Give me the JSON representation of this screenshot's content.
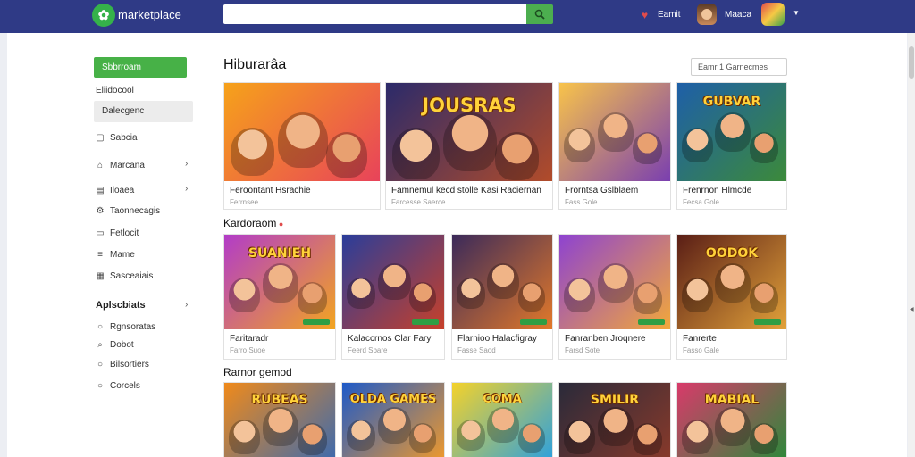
{
  "header": {
    "brand": "marketplace",
    "search_placeholder": "",
    "notif_label": "Eamit",
    "user_label": "Maaca"
  },
  "sidebar": {
    "primary_button": "Sbbrroam",
    "subtitle": "Eliidocool",
    "active_item": "Dalecgenc",
    "items": [
      {
        "label": "Sabcia",
        "icon": "square-icon"
      },
      {
        "label": "Marcana",
        "icon": "tag-icon"
      },
      {
        "label": "Iloaea",
        "icon": "bag-icon"
      },
      {
        "label": "Taonnecagis",
        "icon": "gear-icon"
      },
      {
        "label": "Fetlocit",
        "icon": "doc-icon"
      },
      {
        "label": "Mame",
        "icon": "list-icon"
      },
      {
        "label": "Sasceaiais",
        "icon": "grid-icon"
      }
    ],
    "section_title": "Aplscbiats",
    "section_items": [
      {
        "label": "Rgnsoratas",
        "icon": "circle-icon"
      },
      {
        "label": "Dobot",
        "icon": "search-icon"
      },
      {
        "label": "Bilsortiers",
        "icon": "circle-icon"
      },
      {
        "label": "Corcels",
        "icon": "circle-icon"
      }
    ]
  },
  "main": {
    "section1_title": "Hiburarâa",
    "sort_label": "Eamr   1 Garnecmes",
    "section2_title": "Kardoraom",
    "section3_title": "Rarnor gemod",
    "row1": [
      {
        "title": "Feroontant Hsrachie",
        "meta": "Ferrnsee",
        "colors": [
          "#f6a21a",
          "#e8435a"
        ],
        "overlay": ""
      },
      {
        "title": "Famnemul kecd stolle Kasi Raciernan",
        "meta": "Farcesse  Saerce",
        "colors": [
          "#2b2a6a",
          "#b24c2a"
        ],
        "overlay": "JOUSRAS"
      },
      {
        "title": "Frorntsa Gslblaem",
        "meta": "Fass Gole",
        "colors": [
          "#f8c34a",
          "#7a3fb0"
        ],
        "overlay": ""
      },
      {
        "title": "Frenrnon Hlmcde",
        "meta": "Fecsa Gole",
        "colors": [
          "#1e5fa8",
          "#3c8a3a"
        ],
        "overlay": "GUBVAR"
      }
    ],
    "row2": [
      {
        "title": "Faritaradr",
        "meta": "Farro Suoe",
        "colors": [
          "#b23cc8",
          "#f2a520"
        ],
        "overlay": "SUANIEH"
      },
      {
        "title": "Kalaccrnos Clar Fary",
        "meta": "Feerd Sbare",
        "colors": [
          "#2a3d9a",
          "#c7402a"
        ],
        "overlay": ""
      },
      {
        "title": "Flarnioo Halacfigray",
        "meta": "Fasse Saod",
        "colors": [
          "#3b2a5a",
          "#e2792a"
        ],
        "overlay": ""
      },
      {
        "title": "Fanranben Jroqnere",
        "meta": "Farsd Sote",
        "colors": [
          "#8e43d0",
          "#f2a83a"
        ],
        "overlay": ""
      },
      {
        "title": "Fanrerte",
        "meta": "Fasso Gale",
        "colors": [
          "#5a1e16",
          "#e2a23a"
        ],
        "overlay": "OODOK"
      }
    ],
    "row3": [
      {
        "title": "",
        "meta": "",
        "colors": [
          "#f08a1a",
          "#3a6ab0"
        ],
        "overlay": "RUBEAS"
      },
      {
        "title": "",
        "meta": "",
        "colors": [
          "#1e5ac8",
          "#f29a2a"
        ],
        "overlay": "OLDA GAMES"
      },
      {
        "title": "",
        "meta": "",
        "colors": [
          "#f4d22a",
          "#2aa0e0"
        ],
        "overlay": "COMA"
      },
      {
        "title": "",
        "meta": "",
        "colors": [
          "#2a2a3a",
          "#8a3a2a"
        ],
        "overlay": "SMILIR"
      },
      {
        "title": "",
        "meta": "",
        "colors": [
          "#d83a6a",
          "#2a8a3a"
        ],
        "overlay": "MABIAL"
      }
    ]
  },
  "colors": {
    "topbar": "#2f3a86",
    "primary_green": "#47b147",
    "search_green": "#4cae4f"
  }
}
